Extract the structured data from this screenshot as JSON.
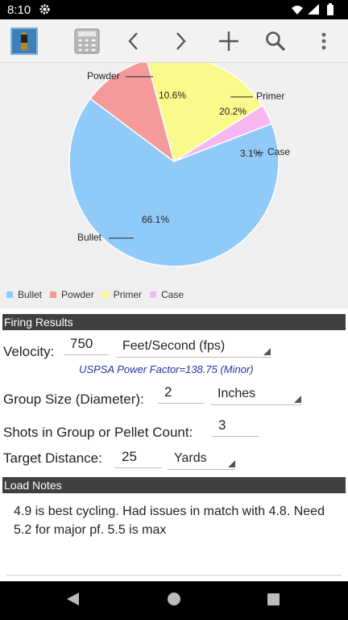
{
  "status_bar": {
    "time": "8:10"
  },
  "chart_data": {
    "type": "pie",
    "slices": [
      {
        "label": "Bullet",
        "value": 66.1,
        "value_label": "66.1%",
        "color": "#90caf9"
      },
      {
        "label": "Powder",
        "value": 10.6,
        "value_label": "10.6%",
        "color": "#f49a9a"
      },
      {
        "label": "Primer",
        "value": 20.2,
        "value_label": "20.2%",
        "color": "#fafa8c"
      },
      {
        "label": "Case",
        "value": 3.1,
        "value_label": "3.1%",
        "color": "#f6b6f0"
      }
    ],
    "legend_position": "bottom-left"
  },
  "firing_results": {
    "header": "Firing Results",
    "velocity_label": "Velocity:",
    "velocity_value": "750",
    "velocity_unit": "Feet/Second (fps)",
    "power_factor": "USPSA Power Factor=138.75 (Minor)",
    "group_size_label": "Group Size (Diameter):",
    "group_size_value": "2",
    "group_size_unit": "Inches",
    "shots_label": "Shots in Group or Pellet Count:",
    "shots_value": "3",
    "distance_label": "Target Distance:",
    "distance_value": "25",
    "distance_unit": "Yards"
  },
  "load_notes": {
    "header": "Load Notes",
    "text": "4.9 is best cycling. Had issues in match with 4.8. Need 5.2 for major pf. 5.5 is max"
  },
  "colors": {
    "header_bg": "#404040",
    "accent_text": "#2233aa"
  }
}
